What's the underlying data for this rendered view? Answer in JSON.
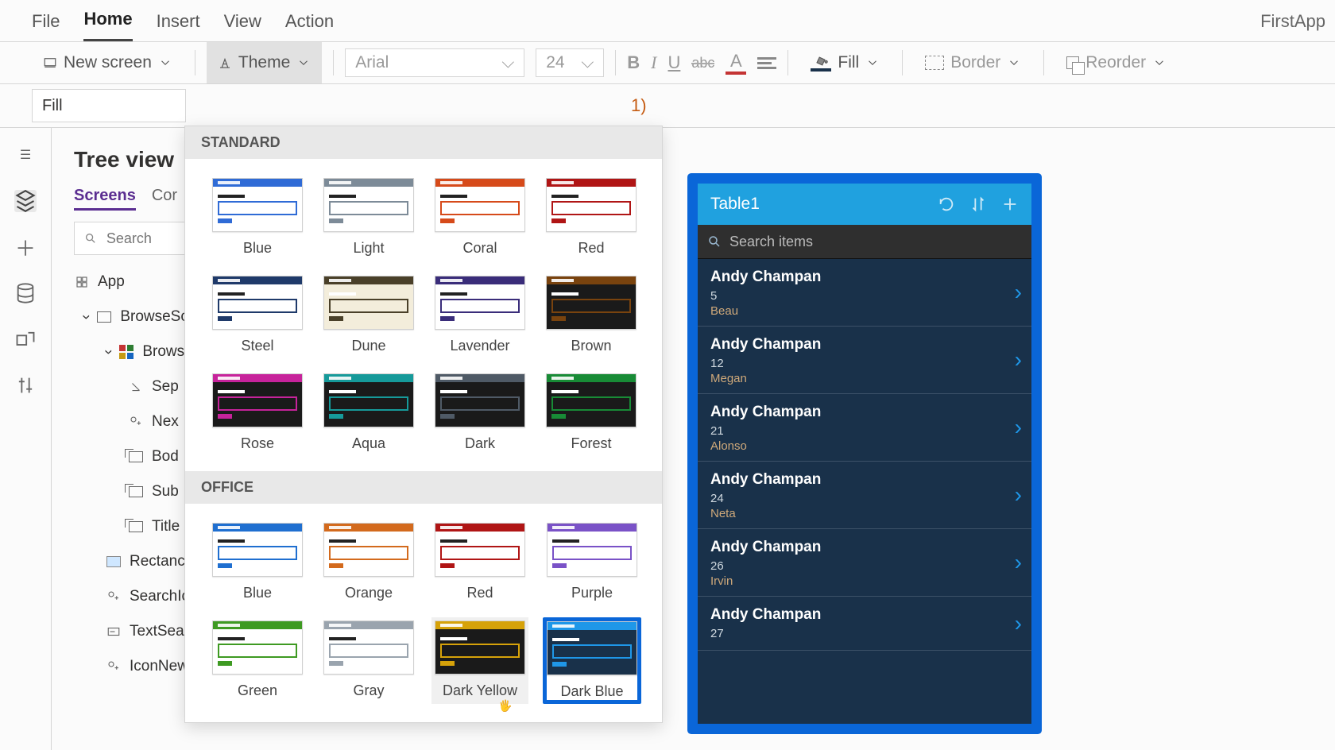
{
  "app_title": "FirstApp",
  "menu": {
    "items": [
      "File",
      "Home",
      "Insert",
      "View",
      "Action"
    ],
    "active_index": 1
  },
  "ribbon": {
    "new_screen_label": "New screen",
    "theme_label": "Theme",
    "font_name": "Arial",
    "font_size": "24",
    "fill_label": "Fill",
    "fill_swatch": "#19314a",
    "font_color_swatch": "#c43434",
    "border_label": "Border",
    "reorder_label": "Reorder"
  },
  "fx": {
    "property": "Fill",
    "value_suffix": "1)"
  },
  "tree": {
    "title": "Tree view",
    "tabs": {
      "active": "Screens",
      "other": "Cor"
    },
    "search_placeholder": "Search",
    "app_label": "App",
    "nodes": [
      {
        "label": "BrowseScreer",
        "type": "screen",
        "indent": 1
      },
      {
        "label": "Browse(",
        "type": "gallery",
        "indent": 2
      },
      {
        "label": "Sep",
        "type": "sep",
        "indent": 3
      },
      {
        "label": "Nex",
        "type": "add",
        "indent": 3
      },
      {
        "label": "Bod",
        "type": "label",
        "indent": 3
      },
      {
        "label": "Sub",
        "type": "label",
        "indent": 3
      },
      {
        "label": "Title",
        "type": "label",
        "indent": 3
      },
      {
        "label": "Rectanc",
        "type": "rect",
        "indent": 2
      },
      {
        "label": "SearchIc",
        "type": "add",
        "indent": 2
      },
      {
        "label": "TextSea",
        "type": "text",
        "indent": 2
      },
      {
        "label": "IconNewItem",
        "type": "add",
        "indent": 2
      }
    ]
  },
  "theme_panel": {
    "groups": [
      {
        "title": "STANDARD",
        "items": [
          {
            "label": "Blue",
            "accent": "#2f6bd6",
            "body": "#ffffff",
            "text": "#333"
          },
          {
            "label": "Light",
            "accent": "#7d8b98",
            "body": "#ffffff",
            "text": "#333"
          },
          {
            "label": "Coral",
            "accent": "#d64a1a",
            "body": "#ffffff",
            "text": "#333"
          },
          {
            "label": "Red",
            "accent": "#b01515",
            "body": "#ffffff",
            "text": "#333"
          },
          {
            "label": "Steel",
            "accent": "#1f3a6a",
            "body": "#ffffff",
            "text": "#333"
          },
          {
            "label": "Dune",
            "accent": "#4a4029",
            "body": "#f3eddb",
            "text": "#4a4029"
          },
          {
            "label": "Lavender",
            "accent": "#3a2d7a",
            "body": "#ffffff",
            "text": "#333"
          },
          {
            "label": "Brown",
            "accent": "#79430e",
            "body": "#1a1a1a",
            "text": "#fff"
          },
          {
            "label": "Rose",
            "accent": "#c7239b",
            "body": "#1a1a1a",
            "text": "#fff"
          },
          {
            "label": "Aqua",
            "accent": "#169a9a",
            "body": "#1a1a1a",
            "text": "#fff"
          },
          {
            "label": "Dark",
            "accent": "#4f5a66",
            "body": "#1a1a1a",
            "text": "#fff"
          },
          {
            "label": "Forest",
            "accent": "#188b36",
            "body": "#1a1a1a",
            "text": "#fff"
          }
        ]
      },
      {
        "title": "OFFICE",
        "items": [
          {
            "label": "Blue",
            "accent": "#1f6fd0",
            "body": "#ffffff",
            "text": "#222",
            "pill": "#1f6fd0"
          },
          {
            "label": "Orange",
            "accent": "#d36a1d",
            "body": "#ffffff",
            "text": "#222",
            "pill": "#d36a1d"
          },
          {
            "label": "Red",
            "accent": "#b01515",
            "body": "#ffffff",
            "text": "#222",
            "pill": "#b01515"
          },
          {
            "label": "Purple",
            "accent": "#7a52c7",
            "body": "#ffffff",
            "text": "#222",
            "pill": "#7a52c7"
          },
          {
            "label": "Green",
            "accent": "#3e9a22",
            "body": "#ffffff",
            "text": "#222",
            "pill": "#3e9a22"
          },
          {
            "label": "Gray",
            "accent": "#9aa4ae",
            "body": "#ffffff",
            "text": "#222",
            "pill": "#9aa4ae"
          },
          {
            "label": "Dark Yellow",
            "accent": "#d6a20a",
            "body": "#1a1a1a",
            "text": "#fff",
            "pill": "#d6a20a",
            "hover": true
          },
          {
            "label": "Dark Blue",
            "accent": "#1f97e8",
            "body": "#19314a",
            "text": "#fff",
            "pill": "#1f97e8",
            "selected": true
          }
        ]
      }
    ]
  },
  "preview": {
    "header_title": "Table1",
    "search_placeholder": "Search items",
    "rows": [
      {
        "name": "Andy Champan",
        "v1": "5",
        "v2": "Beau"
      },
      {
        "name": "Andy Champan",
        "v1": "12",
        "v2": "Megan"
      },
      {
        "name": "Andy Champan",
        "v1": "21",
        "v2": "Alonso"
      },
      {
        "name": "Andy Champan",
        "v1": "24",
        "v2": "Neta"
      },
      {
        "name": "Andy Champan",
        "v1": "26",
        "v2": "Irvin"
      },
      {
        "name": "Andy Champan",
        "v1": "27",
        "v2": ""
      }
    ]
  }
}
